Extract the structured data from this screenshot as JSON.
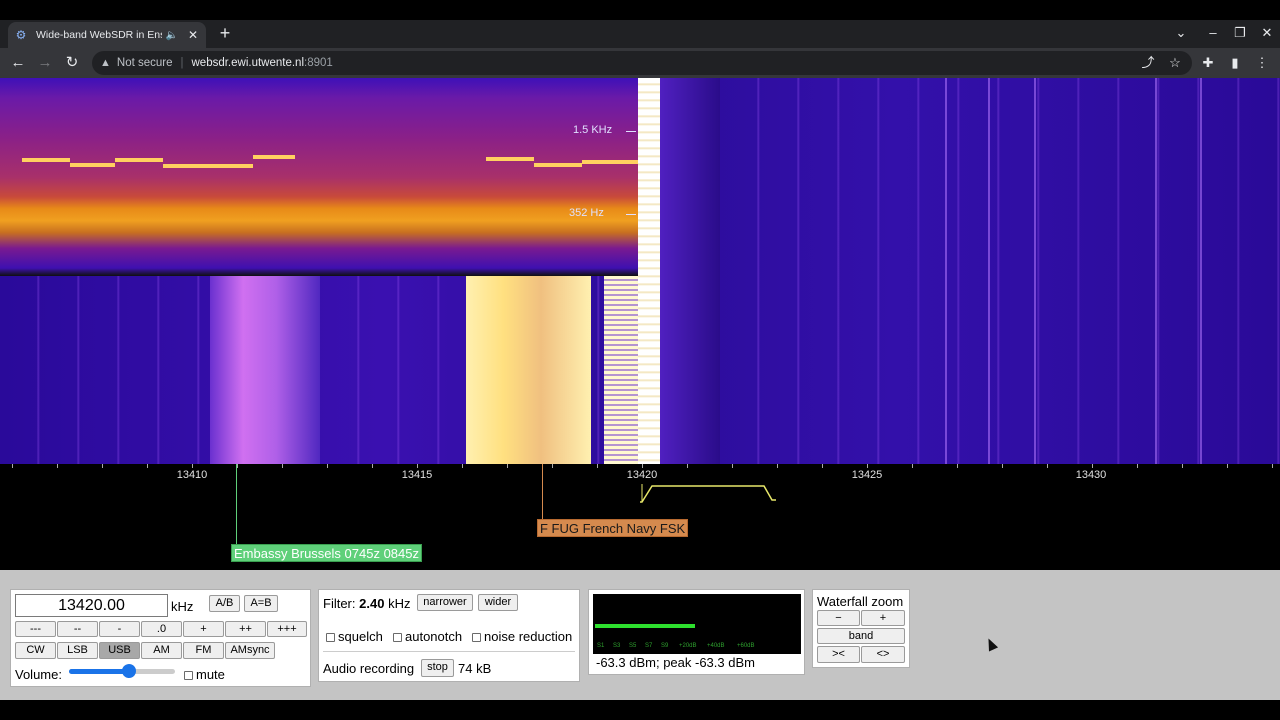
{
  "browser": {
    "tab_title": "Wide-band WebSDR in Ensch",
    "tab_audio_icon": "speaker-icon",
    "url_warning": "Not secure",
    "url_host": "websdr.ewi.utwente.nl",
    "url_port": ":8901"
  },
  "waterfall": {
    "spectrum_labels": [
      "1.5  KHz",
      "352  Hz"
    ]
  },
  "scale": {
    "labels": [
      "13410",
      "13415",
      "13420",
      "13425",
      "13430"
    ]
  },
  "stations": [
    {
      "label": "Embassy Brussels 0745z 0845z",
      "color": "#5fd07a"
    },
    {
      "label": "F FUG French Navy FSK",
      "color": "#d58a4e"
    }
  ],
  "tuning": {
    "frequency": "13420.00",
    "unit": "kHz",
    "ab_label": "A/B",
    "aeqb_label": "A=B",
    "step_buttons": [
      "---",
      "--",
      "-",
      ".0",
      "+",
      "++",
      "+++"
    ],
    "modes": [
      "CW",
      "LSB",
      "USB",
      "AM",
      "FM",
      "AMsync"
    ],
    "active_mode": "USB",
    "volume_label": "Volume:",
    "volume_level": 0.57,
    "mute_label": "mute"
  },
  "filter": {
    "label": "Filter:",
    "width": "2.40",
    "unit": "kHz",
    "narrower_label": "narrower",
    "wider_label": "wider",
    "squelch_label": "squelch",
    "autonotch_label": "autonotch",
    "noise_reduction_label": "noise reduction",
    "recording_label": "Audio recording",
    "stop_label": "stop",
    "recording_size": "74 kB"
  },
  "smeter": {
    "scale_labels": [
      "S1",
      "S3",
      "S5",
      "S7",
      "S9",
      "+20dB",
      "+40dB",
      "+60dB"
    ],
    "level_fraction": 0.49,
    "reading": "-63.3 dBm; peak  -63.3 dBm"
  },
  "zoom": {
    "title": "Waterfall zoom",
    "minus_label": "−",
    "plus_label": "+",
    "band_label": "band",
    "in_label": "><",
    "out_label": "<>"
  }
}
